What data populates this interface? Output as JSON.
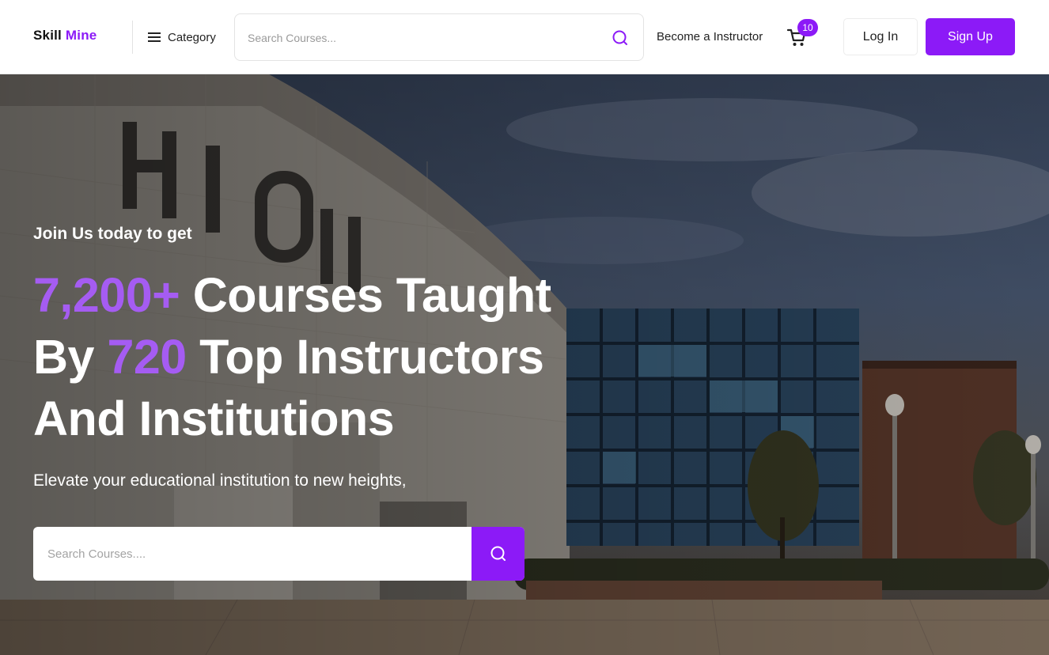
{
  "header": {
    "logo_main": "Skill",
    "logo_accent": "Mine",
    "category_label": "Category",
    "search_placeholder": "Search Courses...",
    "become_instructor": "Become a Instructor",
    "cart_count": "10",
    "login_label": "Log In",
    "signup_label": "Sign Up"
  },
  "hero": {
    "eyebrow": "Join Us today to get",
    "headline": {
      "courses_count": "7,200+",
      "courses_text": " Courses Taught",
      "by_text": "By ",
      "instructors_count": "720",
      "instructors_text": " Top Instructors",
      "institutions_text": "And Institutions"
    },
    "subtitle": "Elevate your educational institution to new heights,",
    "search_placeholder": "Search Courses...."
  },
  "colors": {
    "accent": "#8c1af7",
    "headline_highlight": "#a55cf2"
  },
  "icons": {
    "menu": "hamburger-icon",
    "search": "search-icon",
    "cart": "cart-icon"
  }
}
